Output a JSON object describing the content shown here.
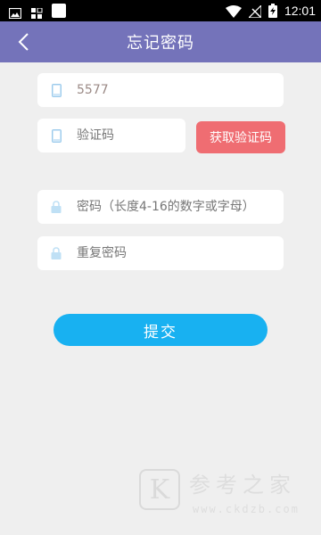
{
  "status_bar": {
    "time": "12:01",
    "left_icons": [
      "gallery-icon",
      "apps-grid-icon",
      "blank-square-icon"
    ],
    "right_icons": [
      "wifi-icon",
      "no-signal-icon",
      "battery-charging-icon"
    ]
  },
  "header": {
    "title": "忘记密码",
    "back_icon": "back-chevron-icon",
    "background": "#7473ba"
  },
  "form": {
    "phone": {
      "value": "5577",
      "icon": "phone-icon"
    },
    "code": {
      "placeholder": "验证码",
      "icon": "phone-icon"
    },
    "get_code_button": "获取验证码",
    "password": {
      "placeholder": "密码（长度4-16的数字或字母）",
      "icon": "lock-icon"
    },
    "repeat_password": {
      "placeholder": "重复密码",
      "icon": "lock-icon"
    },
    "submit_button": "提交"
  },
  "colors": {
    "get_code_button": "#ef6d72",
    "submit_button": "#18b1f1",
    "page_background": "#efefef"
  },
  "watermark": {
    "logo_letter": "K",
    "title": "参考之家",
    "url": "www.ckdzb.com"
  }
}
